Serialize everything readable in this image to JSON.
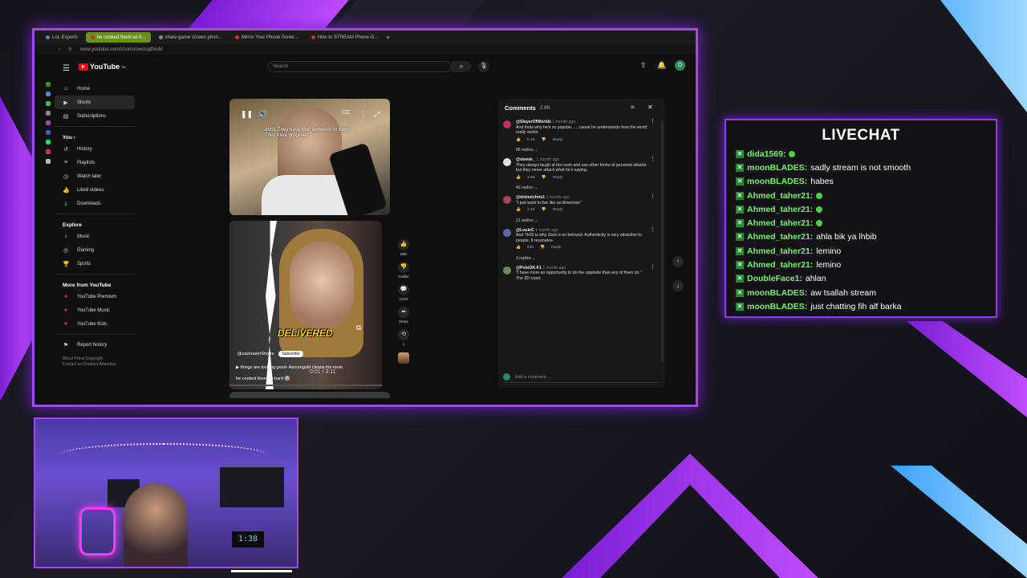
{
  "browser": {
    "tabs": [
      {
        "label": "LoL Esports",
        "active": false
      },
      {
        "label": "he cooked them so h...",
        "active": true
      },
      {
        "label": "share game screen phon...",
        "active": false
      },
      {
        "label": "Mirror Your Phone Scree...",
        "active": false
      },
      {
        "label": "How to STREAM Phone G...",
        "active": false
      }
    ],
    "new_tab": "+",
    "url": "www.youtube.com/shorts/owclog9VuM"
  },
  "youtube": {
    "logo": "YouTube",
    "logo_sup": "TH",
    "search_placeholder": "Search",
    "avatar_letter": "D",
    "sidebar": {
      "main": [
        {
          "label": "Home",
          "icon": "home-icon"
        },
        {
          "label": "Shorts",
          "icon": "shorts-icon",
          "active": true
        },
        {
          "label": "Subscriptions",
          "icon": "subscriptions-icon"
        }
      ],
      "you_heading": "You",
      "you": [
        {
          "label": "History",
          "icon": "history-icon"
        },
        {
          "label": "Playlists",
          "icon": "playlists-icon"
        },
        {
          "label": "Watch later",
          "icon": "watch-later-icon"
        },
        {
          "label": "Liked videos",
          "icon": "liked-videos-icon"
        },
        {
          "label": "Downloads",
          "icon": "downloads-icon"
        }
      ],
      "explore_heading": "Explore",
      "explore": [
        {
          "label": "Music",
          "icon": "music-icon"
        },
        {
          "label": "Gaming",
          "icon": "gaming-icon"
        },
        {
          "label": "Sports",
          "icon": "sports-icon"
        }
      ],
      "more_heading": "More from YouTube",
      "more": [
        {
          "label": "YouTube Premium"
        },
        {
          "label": "YouTube Music"
        },
        {
          "label": "YouTube Kids"
        }
      ],
      "report": "Report history",
      "footer1": "About  Press  Copyright",
      "footer2": "Contact us  Creators  Advertise"
    },
    "short1": {
      "caption": "don't. They have food delivered to them. They have groceries"
    },
    "short2": {
      "overlay_text": "DELIVERED",
      "channel": "@zackrawrrShorts",
      "subscribe": "Subscribe",
      "description": "things are looking good- Asmongold cleans his room",
      "title": "he cooked them so hard 😭",
      "timecode": "0:01 / 3:11",
      "progress": 0.01
    },
    "actions": {
      "likes": "58K",
      "dislike": "Dislike",
      "comments": "2,879",
      "share": "Share",
      "remix": "1"
    },
    "comments": {
      "title": "Comments",
      "count": "2.8K",
      "items": [
        {
          "user": "@SlayerOfWorlds",
          "time": "1 month ago",
          "text": "And thats why he's so popular...... cause he understands how the world really works.",
          "likes": "5.4K",
          "replies": "88 replies",
          "avatar_color": "#c0306a"
        },
        {
          "user": "@stewie_",
          "time": "1 month ago",
          "text": "They always laugh at his room and use other forms of personal attacks but they never attack what he's saying.",
          "likes": "3.6K",
          "replies": "43 replies",
          "avatar_color": "#e0e0e0"
        },
        {
          "user": "@dotnetchris1",
          "time": "1 month ago",
          "text": "\"I just want to live like an American\"",
          "likes": "2.4K",
          "replies": "21 replies",
          "avatar_color": "#b04060"
        },
        {
          "user": "@LouieC",
          "time": "1 month ago",
          "text": "And THIS is why Zack is so beloved. Authenticity is very attractive to people. It resonates.",
          "likes": "538",
          "replies": "3 replies",
          "avatar_color": "#5a6ab0"
        },
        {
          "user": "@PoloOK-F1",
          "time": "1 month ago",
          "text": "\"I have more an opportunity to do the opposite than any of them do.\" The 3D roast.",
          "likes": "",
          "replies": "",
          "avatar_color": "#6a8a5a"
        }
      ],
      "reply_label": "Reply",
      "add_placeholder": "Add a comment..."
    }
  },
  "livechat": {
    "title": "LIVECHAT",
    "badge": "✕",
    "messages": [
      {
        "user": "dida1569:",
        "text": "",
        "emote": true
      },
      {
        "user": "moonBLADES:",
        "text": "sadly stream is not smooth",
        "emote": false
      },
      {
        "user": "moonBLADES:",
        "text": "habes",
        "emote": false
      },
      {
        "user": "Ahmed_taher21:",
        "text": "",
        "emote": true
      },
      {
        "user": "Ahmed_taher21:",
        "text": "",
        "emote": true
      },
      {
        "user": "Ahmed_taher21:",
        "text": "",
        "emote": true
      },
      {
        "user": "Ahmed_taher21:",
        "text": "ahla bik ya lhbib",
        "emote": false
      },
      {
        "user": "Ahmed_taher21:",
        "text": "lemino",
        "emote": false
      },
      {
        "user": "Ahmed_taher21:",
        "text": "lemino",
        "emote": false
      },
      {
        "user": "DoubleFace1:",
        "text": "ahlan",
        "emote": false
      },
      {
        "user": "moonBLADES:",
        "text": "aw tsallah stream",
        "emote": false
      },
      {
        "user": "moonBLADES:",
        "text": "just chatting fih alf barka",
        "emote": false
      }
    ]
  },
  "webcam": {
    "clock": "1:38"
  },
  "colors": {
    "accent_purple": "#9b4cf0",
    "accent_blue": "#3aa0ff",
    "chat_user": "#7cf06a",
    "yt_red": "#ff0000"
  }
}
